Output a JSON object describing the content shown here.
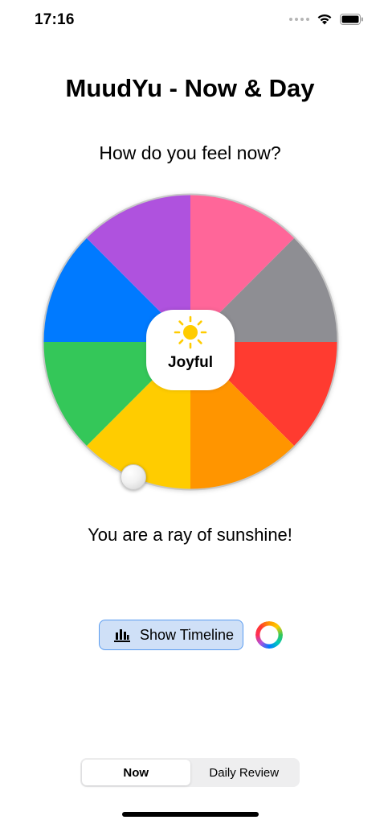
{
  "status_bar": {
    "time": "17:16"
  },
  "header": {
    "title": "MuudYu - Now & Day"
  },
  "prompt": {
    "question": "How do you feel now?"
  },
  "mood_wheel": {
    "segments": [
      {
        "color": "#FF6699"
      },
      {
        "color": "#8E8E93"
      },
      {
        "color": "#FF3B30"
      },
      {
        "color": "#FF9500"
      },
      {
        "color": "#FFCC00"
      },
      {
        "color": "#34C759"
      },
      {
        "color": "#007AFF"
      },
      {
        "color": "#AF52DE"
      }
    ],
    "selected": {
      "label": "Joyful",
      "icon": "sun-icon",
      "icon_color": "#FFCC00"
    },
    "message": "You are a ray of sunshine!"
  },
  "actions": {
    "timeline_label": "Show Timeline",
    "timeline_icon": "bar-chart-icon",
    "color_ring_icon": "color-wheel-icon"
  },
  "segmented_control": {
    "options": [
      "Now",
      "Daily Review"
    ],
    "selected": "Now"
  }
}
